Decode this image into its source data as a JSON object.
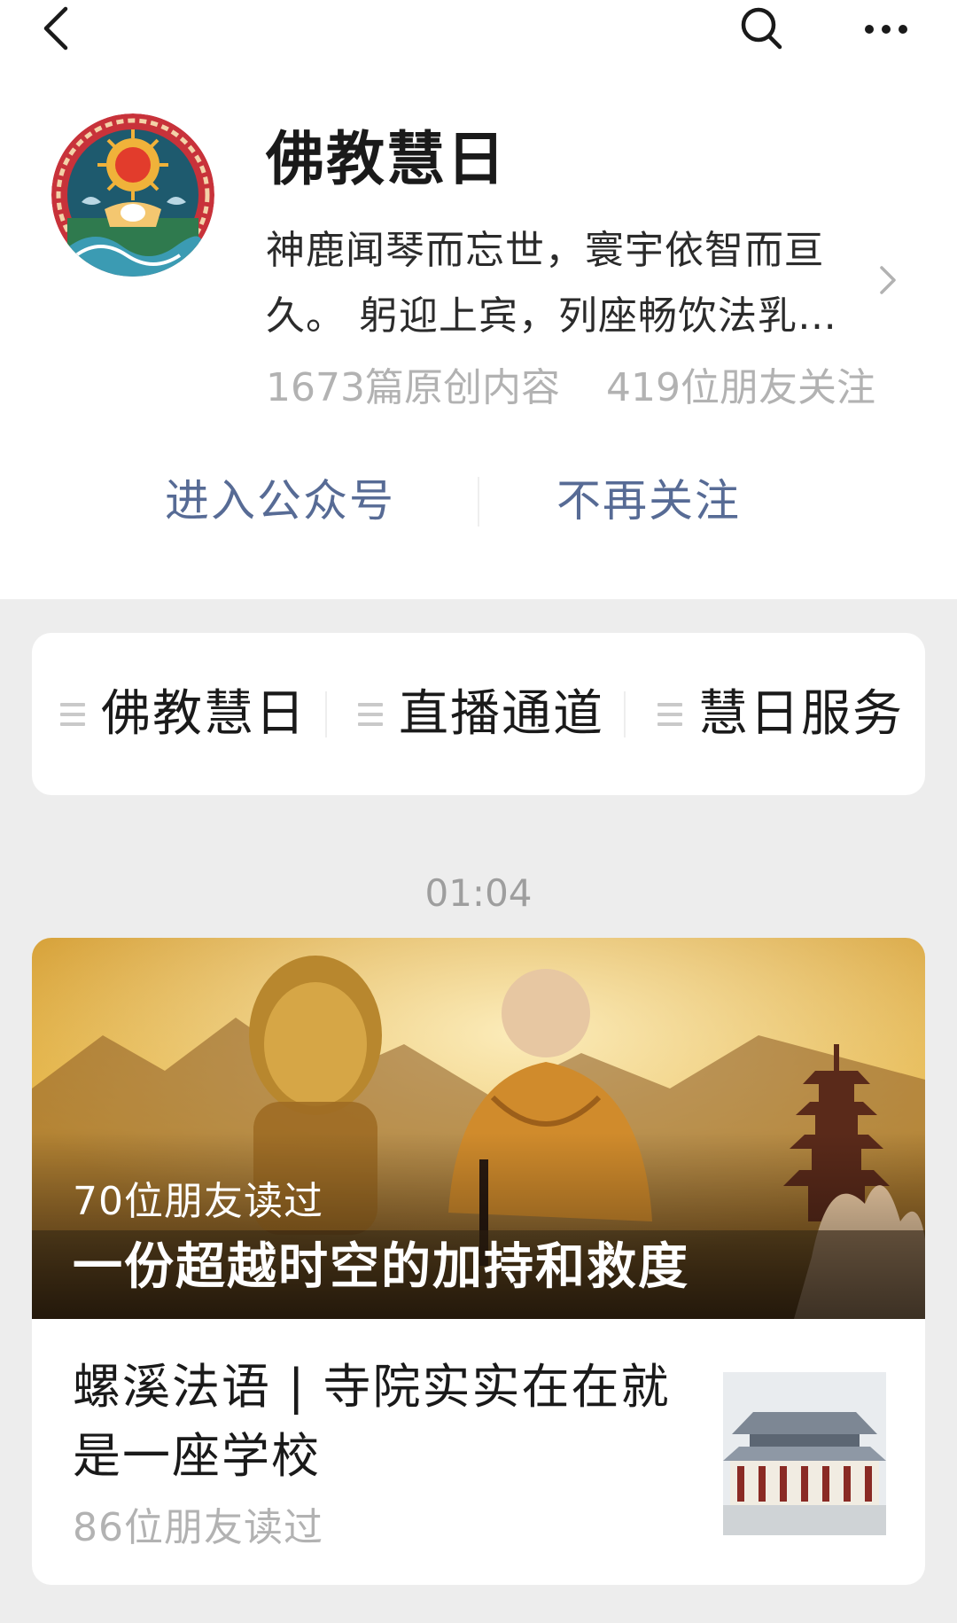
{
  "topbar": {
    "back_icon": "chevron-left-icon",
    "search_icon": "search-icon",
    "more_icon": "more-dots-icon"
  },
  "account": {
    "name": "佛教慧日",
    "description": "神鹿闻琴而忘世，寰宇依智而亘久。 躬迎上宾，列座畅饮法乳…",
    "original_count": "1673篇原创内容",
    "followers": "419位朋友关注",
    "enter_label": "进入公众号",
    "unfollow_label": "不再关注"
  },
  "menu": {
    "items": [
      {
        "label": "佛教慧日"
      },
      {
        "label": "直播通道"
      },
      {
        "label": "慧日服务"
      }
    ]
  },
  "feed": {
    "timestamp": "01:04",
    "top_article": {
      "reads": "70位朋友读过",
      "title": "一份超越时空的加持和救度"
    },
    "sub_article": {
      "title": "螺溪法语 | 寺院实实在在就是一座学校",
      "reads": "86位朋友读过"
    }
  },
  "colors": {
    "link_blue": "#576b95",
    "background": "#ededed",
    "muted_text": "#b2b2b2"
  }
}
